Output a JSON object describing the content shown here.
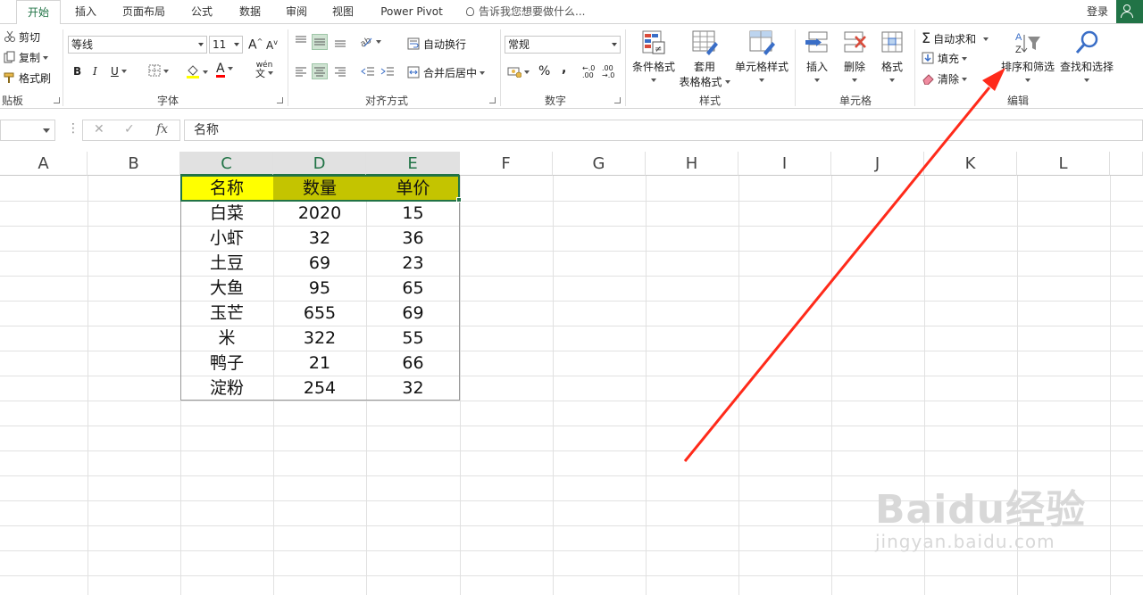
{
  "tabs": [
    "开始",
    "插入",
    "页面布局",
    "公式",
    "数据",
    "审阅",
    "视图",
    "Power Pivot"
  ],
  "tell_me": "告诉我您想要做什么...",
  "login": "登录",
  "ribbon": {
    "clipboard": {
      "cut": "剪切",
      "copy": "复制",
      "format_painter": "格式刷",
      "label": "贴板"
    },
    "font": {
      "name": "等线",
      "size": "11",
      "bold": "B",
      "italic": "I",
      "underline": "U",
      "phonetic": "wén",
      "label": "字体"
    },
    "alignment": {
      "wrap": "自动换行",
      "merge": "合并后居中",
      "label": "对齐方式"
    },
    "number": {
      "format": "常规",
      "percent": "%",
      "comma": ",",
      "label": "数字"
    },
    "styles": {
      "conditional": "条件格式",
      "table_fmt_1": "套用",
      "table_fmt_2": "表格格式",
      "cell_styles": "单元格样式",
      "label": "样式"
    },
    "cells": {
      "insert": "插入",
      "delete": "删除",
      "format": "格式",
      "label": "单元格"
    },
    "editing": {
      "autosum": "自动求和",
      "fill": "填充",
      "clear": "清除",
      "sort_filter": "排序和筛选",
      "find_select": "查找和选择",
      "label": "编辑"
    }
  },
  "formula_bar": {
    "fx": "fx",
    "content": "名称"
  },
  "columns": [
    "A",
    "B",
    "C",
    "D",
    "E",
    "F",
    "G",
    "H",
    "I",
    "J",
    "K",
    "L"
  ],
  "table": {
    "headers": [
      "名称",
      "数量",
      "单价"
    ],
    "rows": [
      [
        "白菜",
        "2020",
        "15"
      ],
      [
        "小虾",
        "32",
        "36"
      ],
      [
        "土豆",
        "69",
        "23"
      ],
      [
        "大鱼",
        "95",
        "65"
      ],
      [
        "玉芒",
        "655",
        "69"
      ],
      [
        "米",
        "322",
        "55"
      ],
      [
        "鸭子",
        "21",
        "66"
      ],
      [
        "淀粉",
        "254",
        "32"
      ]
    ]
  },
  "colors": {
    "accent": "#217346",
    "header_yellow": "#ffff00",
    "header_olive": "#c4c400",
    "arrow": "#ff2a1a"
  },
  "watermark": {
    "main": "Baidu经验",
    "sub": "jingyan.baidu.com"
  }
}
